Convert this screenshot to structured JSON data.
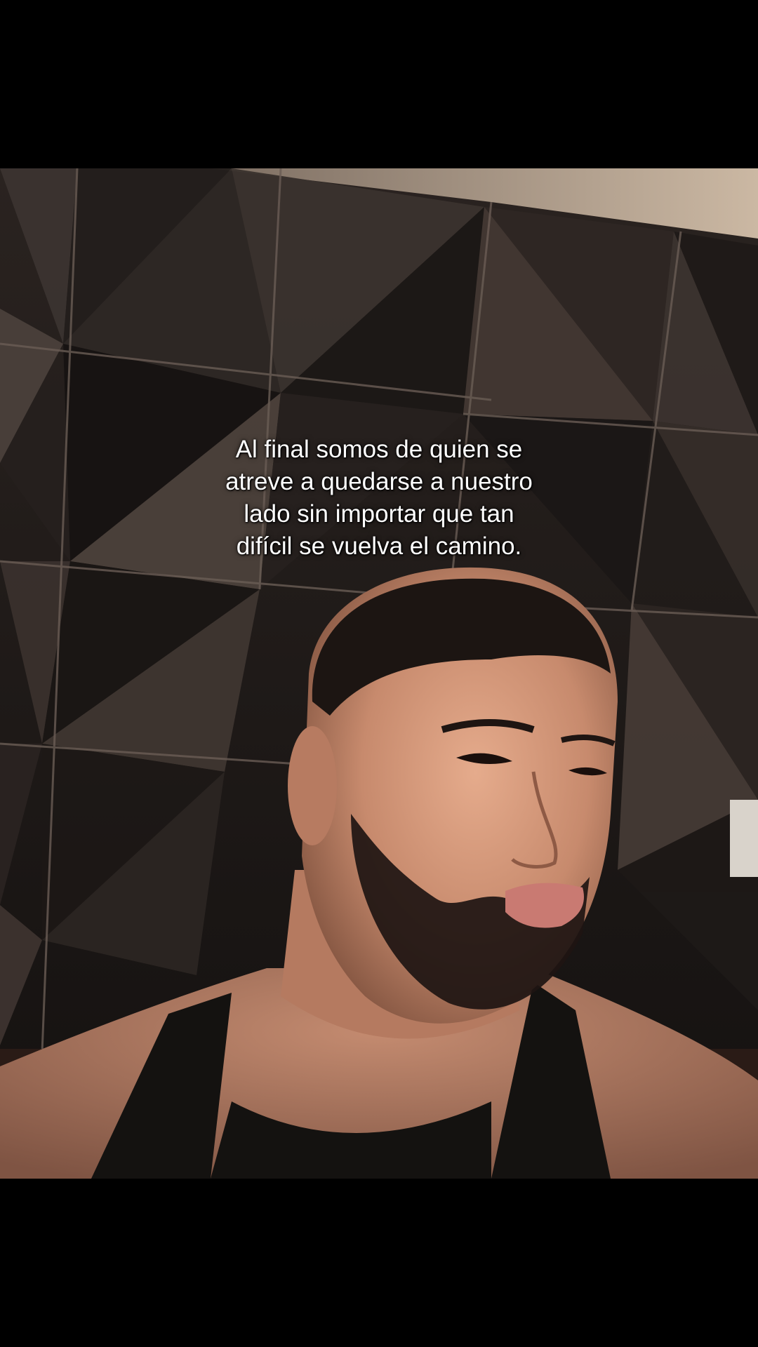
{
  "video": {
    "caption_lines": [
      "Al final somos de quien se",
      "atreve a quedarse a nuestro",
      "lado sin importar que tan",
      "difícil se vuelva el camino."
    ]
  },
  "colors": {
    "letterbox": "#000000",
    "wall": "#1b1715",
    "panel_highlight": "#5a4e48",
    "ceiling": "#c9b6a1",
    "skin": "#c98e74",
    "shirt": "#141210",
    "beard": "#1e1512"
  }
}
